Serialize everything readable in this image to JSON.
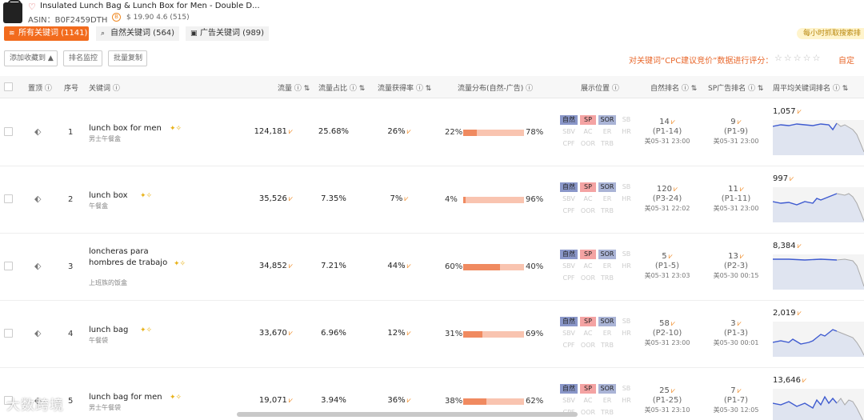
{
  "product": {
    "title": "Insulated Lunch Bag & Lunch Box for Men - Double D...",
    "asin": "ASIN：B0F2459DTH",
    "badge": "B",
    "price_rating": "$ 19.90 4.6 (515)"
  },
  "tabs": [
    {
      "label": "所有关键词 (1141)",
      "icon": "layers-icon"
    },
    {
      "label": "自然关键词 (564)",
      "icon": "search-icon"
    },
    {
      "label": "广告关键词 (989)",
      "icon": "ad-icon"
    }
  ],
  "hourly_badge": "每小时抓取搜索排",
  "toolbar": {
    "add_favorite": "添加收藏到 ▲",
    "rank_monitor": "排名监控",
    "batch_copy": "批量复制",
    "cpc_text": "对关键词“CPC建议竞价”数据进行评分：",
    "stars": "☆☆☆☆☆",
    "custom": "自定"
  },
  "columns": {
    "pin": "置顶",
    "index": "序号",
    "keyword": "关键词",
    "traffic": "流量",
    "traffic_share": "流量占比",
    "traffic_win": "流量获得率",
    "traffic_dist": "流量分布(自然-广告)",
    "display": "展示位置",
    "organic_rank": "自然排名",
    "sp_rank": "SP广告排名",
    "weekly": "周平均关键词排名"
  },
  "position_labels": [
    "自然",
    "SP",
    "SOR",
    "SB",
    "SBV",
    "AC",
    "ER",
    "HR",
    "CPF",
    "OOR",
    "TRB"
  ],
  "rows": [
    {
      "index": "1",
      "keyword_line1": "lunch box for men",
      "keyword_line2": "",
      "keyword_cn": "男士午餐盒",
      "traffic": "124,181",
      "share": "25.68%",
      "win": "26%",
      "organic_pct": "22%",
      "ad_pct": "78%",
      "organic_share": 22,
      "organic_rank": "14",
      "organic_page": "(P1-14)",
      "organic_date": "美05-31 23:00",
      "sp_rank": "9",
      "sp_page": "(P1-9)",
      "sp_date": "美05-31 23:00",
      "weekly": "1,057"
    },
    {
      "index": "2",
      "keyword_line1": "lunch box",
      "keyword_line2": "",
      "keyword_cn": "午餐盒",
      "traffic": "35,526",
      "share": "7.35%",
      "win": "7%",
      "organic_pct": "4%",
      "ad_pct": "96%",
      "organic_share": 4,
      "organic_rank": "120",
      "organic_page": "(P3-24)",
      "organic_date": "美05-31 22:02",
      "sp_rank": "11",
      "sp_page": "(P1-11)",
      "sp_date": "美05-31 23:00",
      "weekly": "997"
    },
    {
      "index": "3",
      "keyword_line1": "loncheras para",
      "keyword_line2": "hombres de trabajo",
      "keyword_cn": "上班族的饭盒",
      "traffic": "34,852",
      "share": "7.21%",
      "win": "44%",
      "organic_pct": "60%",
      "ad_pct": "40%",
      "organic_share": 60,
      "organic_rank": "5",
      "organic_page": "(P1-5)",
      "organic_date": "美05-31 23:03",
      "sp_rank": "13",
      "sp_page": "(P2-3)",
      "sp_date": "美05-30 00:15",
      "weekly": "8,384"
    },
    {
      "index": "4",
      "keyword_line1": "lunch bag",
      "keyword_line2": "",
      "keyword_cn": "午餐袋",
      "traffic": "33,670",
      "share": "6.96%",
      "win": "12%",
      "organic_pct": "31%",
      "ad_pct": "69%",
      "organic_share": 31,
      "organic_rank": "58",
      "organic_page": "(P2-10)",
      "organic_date": "美05-31 23:00",
      "sp_rank": "3",
      "sp_page": "(P1-3)",
      "sp_date": "美05-30 00:01",
      "weekly": "2,019"
    },
    {
      "index": "5",
      "keyword_line1": "lunch bag for men",
      "keyword_line2": "",
      "keyword_cn": "男士午餐袋",
      "traffic": "19,071",
      "share": "3.94%",
      "win": "36%",
      "organic_pct": "38%",
      "ad_pct": "62%",
      "organic_share": 38,
      "organic_rank": "25",
      "organic_page": "(P1-25)",
      "organic_date": "美05-31 23:10",
      "sp_rank": "7",
      "sp_page": "(P1-7)",
      "sp_date": "美05-30 12:05",
      "weekly": "13,646"
    }
  ],
  "colors": {
    "accent": "#f26b1d",
    "organic": "#8a97c9",
    "sp": "#f4a3a3",
    "sor": "#aab4d6",
    "spark": "#3f5bd0"
  },
  "watermark": "大数跨境"
}
